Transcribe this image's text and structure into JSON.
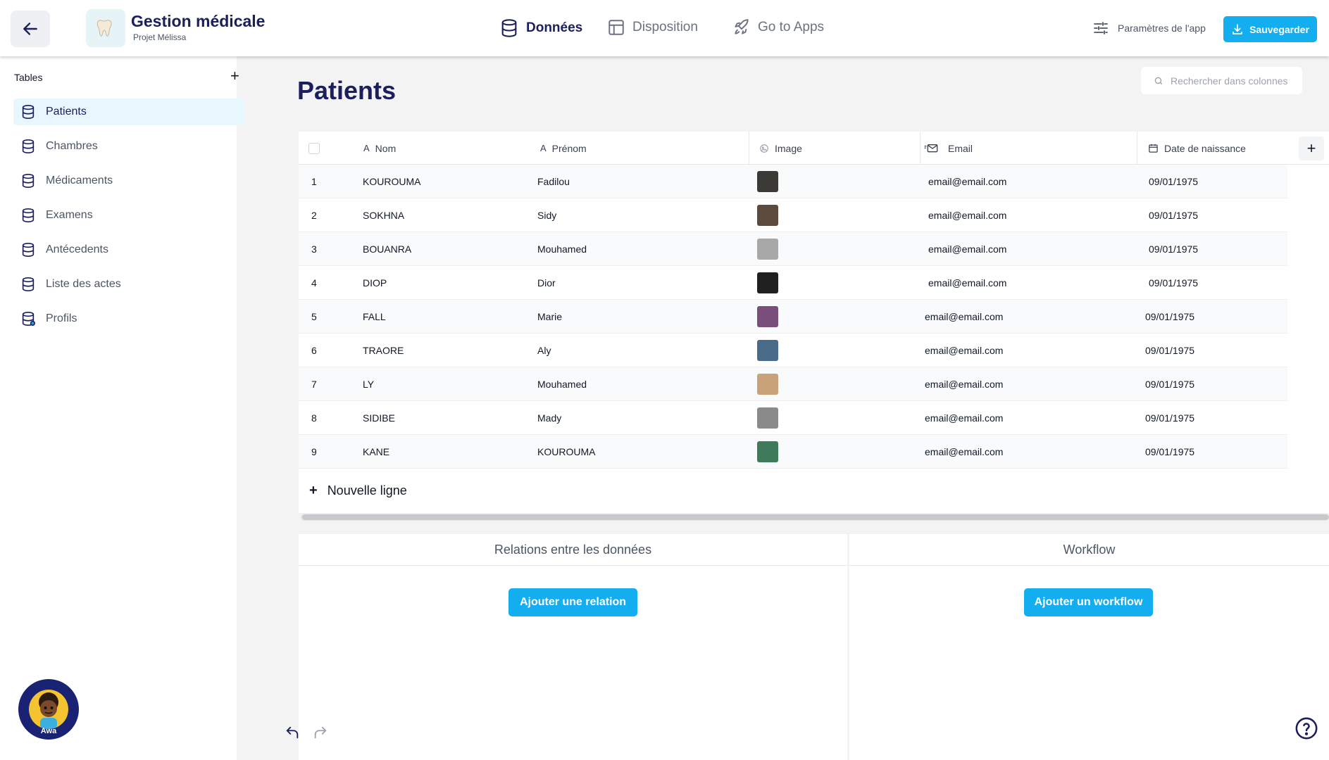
{
  "header": {
    "app_title": "Gestion médicale",
    "app_subtitle": "Projet Mélissa",
    "nav": [
      {
        "label": "Données",
        "icon": "database-icon",
        "active": true
      },
      {
        "label": "Disposition",
        "icon": "layout-icon",
        "active": false
      },
      {
        "label": "Go to Apps",
        "icon": "rocket-icon",
        "active": false
      }
    ],
    "settings_label": "Paramètres de l'app",
    "save_label": "Sauvegarder"
  },
  "sidebar": {
    "heading": "Tables",
    "add_label": "+",
    "items": [
      {
        "label": "Patients",
        "active": true
      },
      {
        "label": "Chambres",
        "active": false
      },
      {
        "label": "Médicaments",
        "active": false
      },
      {
        "label": "Examens",
        "active": false
      },
      {
        "label": "Antécedents",
        "active": false
      },
      {
        "label": "Liste des actes",
        "active": false
      },
      {
        "label": "Profils",
        "active": false
      }
    ],
    "assistant_name": "Awa"
  },
  "main": {
    "title": "Patients",
    "search_placeholder": "Rechercher dans colonnes",
    "columns": [
      {
        "label": "Nom",
        "type_icon": "A"
      },
      {
        "label": "Prénom",
        "type_icon": "A"
      },
      {
        "label": "Image",
        "type_icon": "image-icon"
      },
      {
        "label": "Email",
        "type_icon": "email-icon"
      },
      {
        "label": "Date de naissance",
        "type_icon": "calendar-icon"
      }
    ],
    "rows": [
      {
        "n": "1",
        "nom": "KOUROUMA",
        "prenom": "Fadilou",
        "email": "email@email.com",
        "date": "09/01/1975",
        "thumb": "#3b3a36"
      },
      {
        "n": "2",
        "nom": "SOKHNA",
        "prenom": "Sidy",
        "email": "email@email.com",
        "date": "09/01/1975",
        "thumb": "#5c4a3c"
      },
      {
        "n": "3",
        "nom": "BOUANRA",
        "prenom": "Mouhamed",
        "email": "email@email.com",
        "date": "09/01/1975",
        "thumb": "#a8a8a8"
      },
      {
        "n": "4",
        "nom": "DIOP",
        "prenom": "Dior",
        "email": "email@email.com",
        "date": "09/01/1975",
        "thumb": "#1f1f1f"
      },
      {
        "n": "5",
        "nom": "FALL",
        "prenom": "Marie",
        "email": "email@email.com",
        "date": "09/01/1975",
        "thumb": "#7a4e7a"
      },
      {
        "n": "6",
        "nom": "TRAORE",
        "prenom": "Aly",
        "email": "email@email.com",
        "date": "09/01/1975",
        "thumb": "#4a6a8a"
      },
      {
        "n": "7",
        "nom": "LY",
        "prenom": "Mouhamed",
        "email": "email@email.com",
        "date": "09/01/1975",
        "thumb": "#c9a27a"
      },
      {
        "n": "8",
        "nom": "SIDIBE",
        "prenom": "Mady",
        "email": "email@email.com",
        "date": "09/01/1975",
        "thumb": "#8a8a8a"
      },
      {
        "n": "9",
        "nom": "KANE",
        "prenom": "KOUROUMA",
        "email": "email@email.com",
        "date": "09/01/1975",
        "thumb": "#3f7a5a"
      }
    ],
    "new_row_label": "Nouvelle ligne",
    "relations": {
      "title": "Relations entre les données",
      "button": "Ajouter une relation"
    },
    "workflow": {
      "title": "Workflow",
      "button": "Ajouter un workflow"
    }
  },
  "colors": {
    "accent": "#12aef0",
    "navy": "#1b1f5c",
    "active_bg": "#e8f7fd"
  }
}
